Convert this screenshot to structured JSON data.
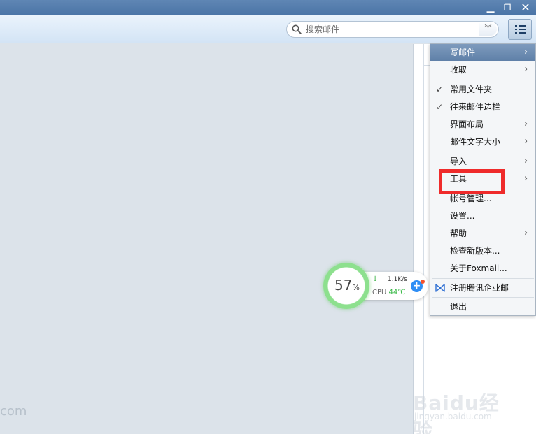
{
  "window": {
    "controls": {
      "minimize_icon": "minimize-icon",
      "restore_icon": "restore-icon",
      "close_icon": "close-icon"
    }
  },
  "toolbar": {
    "search": {
      "placeholder": "搜索邮件",
      "icon": "search-icon",
      "dropdown_icon": "double-chevron-down-icon"
    },
    "menu_button_icon": "list-menu-icon"
  },
  "menu": {
    "items": [
      {
        "label": "写邮件",
        "submenu": true,
        "highlighted": true
      },
      {
        "label": "收取",
        "submenu": true
      },
      {
        "label": "常用文件夹",
        "checked": true
      },
      {
        "label": "往来邮件边栏",
        "checked": true
      },
      {
        "label": "界面布局",
        "submenu": true
      },
      {
        "label": "邮件文字大小",
        "submenu": true
      },
      {
        "label": "导入",
        "submenu": true
      },
      {
        "label": "工具",
        "submenu": true,
        "annotated": true
      },
      {
        "label": "帐号管理..."
      },
      {
        "label": "设置..."
      },
      {
        "label": "帮助",
        "submenu": true
      },
      {
        "label": "检查新版本..."
      },
      {
        "label": "关于Foxmail..."
      },
      {
        "label": "注册腾讯企业邮",
        "icon": "tencent-exmail-icon"
      },
      {
        "label": "退出"
      }
    ],
    "arrow": "›",
    "check": "✓",
    "annotation_color": "#ef2b2b"
  },
  "widget": {
    "percent": "57",
    "percent_unit": "%",
    "speed": "1.1K/s",
    "speed_arrow": "↓",
    "cpu_label": "CPU",
    "cpu_temp": "44℃",
    "plus": "+"
  },
  "watermark": {
    "left_text": "com",
    "brand": "Baidu经验",
    "sub": "jingyan.baidu.com"
  }
}
